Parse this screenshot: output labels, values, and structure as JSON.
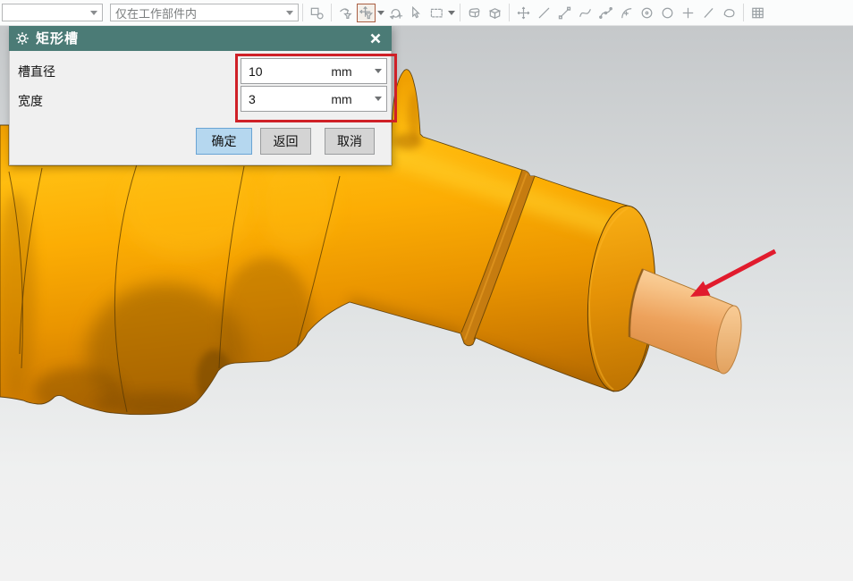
{
  "toolbar": {
    "selection_filter": {
      "value": ""
    },
    "scope_selector": {
      "value": "仅在工作部件内"
    },
    "icons": [
      "assembly-constraints-icon",
      "arrow-filter-icon",
      "snap-point-filter-icon",
      "chevron-down-icon",
      "reset-filter-icon",
      "select-pointer-icon",
      "selection-rectangle-icon",
      "wireframe-solid-icon",
      "solid-cube-icon",
      "snap-point-icon",
      "line-icon",
      "line-endpoints-icon",
      "curve-icon",
      "spline-points-icon",
      "arc-center-icon",
      "circle-center-icon",
      "circle-icon",
      "point-plus-icon",
      "slash-icon",
      "face-icon",
      "grid-icon"
    ]
  },
  "dialog": {
    "title": "矩形槽",
    "fields": [
      {
        "label": "槽直径",
        "value": "10",
        "unit": "mm"
      },
      {
        "label": "宽度",
        "value": "3",
        "unit": "mm"
      }
    ],
    "buttons": [
      {
        "label": "确定"
      },
      {
        "label": "返回"
      },
      {
        "label": "取消"
      }
    ]
  },
  "annotations": {
    "highlight_box_color": "#cf2027",
    "arrow_color": "#e11b2d"
  },
  "colors": {
    "dialog_titlebar": "#4b7b76",
    "dialog_body": "#f0f0f0",
    "ok_button_bg": "#b5d7ef",
    "model_orange": "#f7a400",
    "viewport_top": "#c5c8ca",
    "viewport_bottom": "#f2f2f2"
  },
  "scene": {
    "description": "orange stepped shaft model with rectangular groove, red arrow pointing to end journal"
  }
}
